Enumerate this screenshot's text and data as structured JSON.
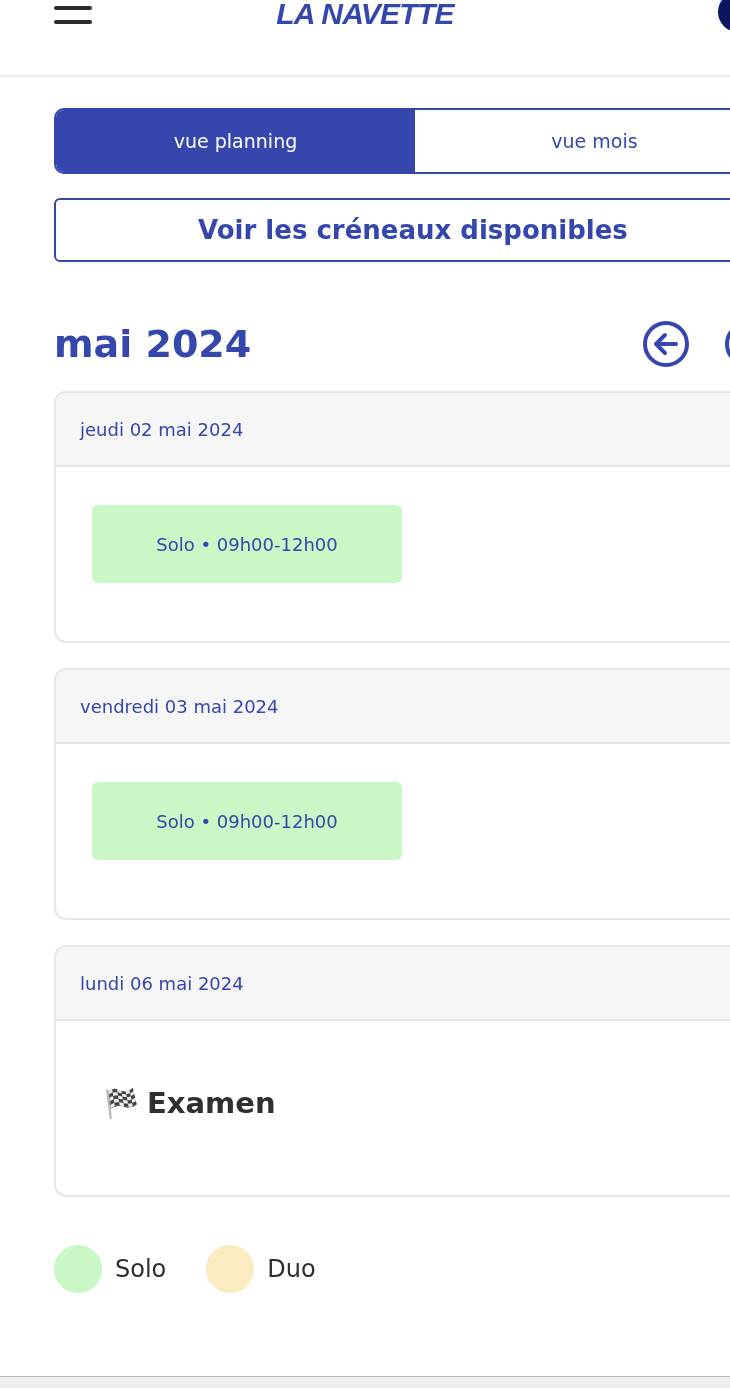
{
  "header": {
    "logo": "LA NAVETTE"
  },
  "view_tabs": [
    {
      "label": "vue planning",
      "selected": true
    },
    {
      "label": "vue mois",
      "selected": false
    }
  ],
  "slots_button": "Voir les créneaux disponibles",
  "month": "mai 2024",
  "days": [
    {
      "date": "jeudi 02 mai 2024",
      "events": [
        {
          "kind": "slot",
          "label": "Solo • 09h00-12h00",
          "color": "#c9f7c5"
        }
      ]
    },
    {
      "date": "vendredi 03 mai 2024",
      "events": [
        {
          "kind": "slot",
          "label": "Solo • 09h00-12h00",
          "color": "#c9f7c5"
        }
      ]
    },
    {
      "date": "lundi 06 mai 2024",
      "events": [
        {
          "kind": "exam",
          "icon": "🏁",
          "label": "Examen"
        }
      ]
    }
  ],
  "legend": [
    {
      "label": "Solo",
      "color": "#c9f7c5"
    },
    {
      "label": "Duo",
      "color": "#faebc1"
    }
  ]
}
